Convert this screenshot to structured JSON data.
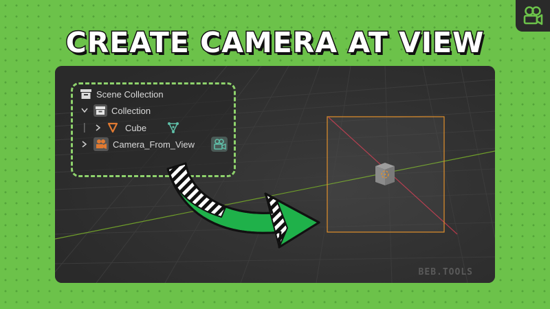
{
  "headline": "CREATE CAMERA AT VIEW",
  "watermark": "BEB.TOOLS",
  "outliner": {
    "items": [
      {
        "label": "Scene Collection",
        "icon": "scene-collection-icon"
      },
      {
        "label": "Collection",
        "icon": "collection-icon",
        "expander": "expanded"
      },
      {
        "label": "Cube",
        "icon": "mesh-object-icon",
        "data_icon": "mesh-data-icon",
        "expander": "collapsed"
      },
      {
        "label": "Camera_From_View",
        "icon": "camera-object-icon",
        "data_icon": "camera-data-icon",
        "expander": "collapsed"
      }
    ]
  },
  "colors": {
    "background": "#6cc24a",
    "outliner_border": "#8ed26c",
    "arrow_fill": "#1fb14a",
    "camera_frame": "#e2902b",
    "x_axis": "#b3394a",
    "y_axis": "#6f9e2a",
    "object_orange": "#e07a32",
    "data_green": "#5fbfa8"
  },
  "icons": [
    "camera-logo-icon",
    "curved-arrow-icon"
  ]
}
